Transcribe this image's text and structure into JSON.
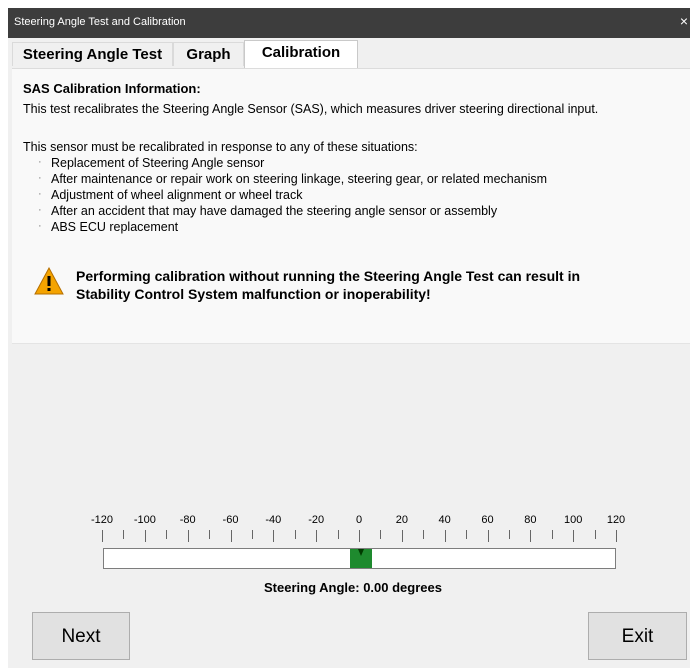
{
  "window": {
    "title": "Steering Angle Test and Calibration",
    "close_glyph": "×"
  },
  "tabs": [
    {
      "label": "Steering Angle Test"
    },
    {
      "label": "Graph"
    },
    {
      "label": "Calibration",
      "active": true
    }
  ],
  "info": {
    "heading": "SAS Calibration Information:",
    "description": "This test recalibrates the Steering Angle Sensor (SAS), which measures driver steering directional input.",
    "situations_intro": "This sensor must be recalibrated in response to any of these situations:",
    "situations": [
      "Replacement of Steering Angle sensor",
      "After maintenance or repair work on steering linkage, steering gear, or related mechanism",
      "Adjustment of wheel alignment or wheel track",
      "After an accident that may have damaged the steering angle sensor or assembly",
      "ABS ECU replacement"
    ],
    "bullet_glyph": "·",
    "warning_icon": "warning-triangle-icon",
    "warning_line1": "Performing calibration without running the Steering Angle Test can result in",
    "warning_line2": "Stability Control System malfunction or inoperability!"
  },
  "gauge": {
    "scale_labels": [
      "-120",
      "-100",
      "-80",
      "-60",
      "-40",
      "-20",
      "0",
      "20",
      "40",
      "60",
      "80",
      "100",
      "120"
    ],
    "min": -120,
    "max": 120,
    "angle": 0.0,
    "needle_color": "#1e8a2e",
    "readout": "Steering Angle: 0.00 degrees"
  },
  "buttons": {
    "next": "Next",
    "exit": "Exit"
  },
  "colors": {
    "titlebar": "#3d3d3d",
    "background": "#f0f0f0",
    "warning": "#f4a300"
  }
}
